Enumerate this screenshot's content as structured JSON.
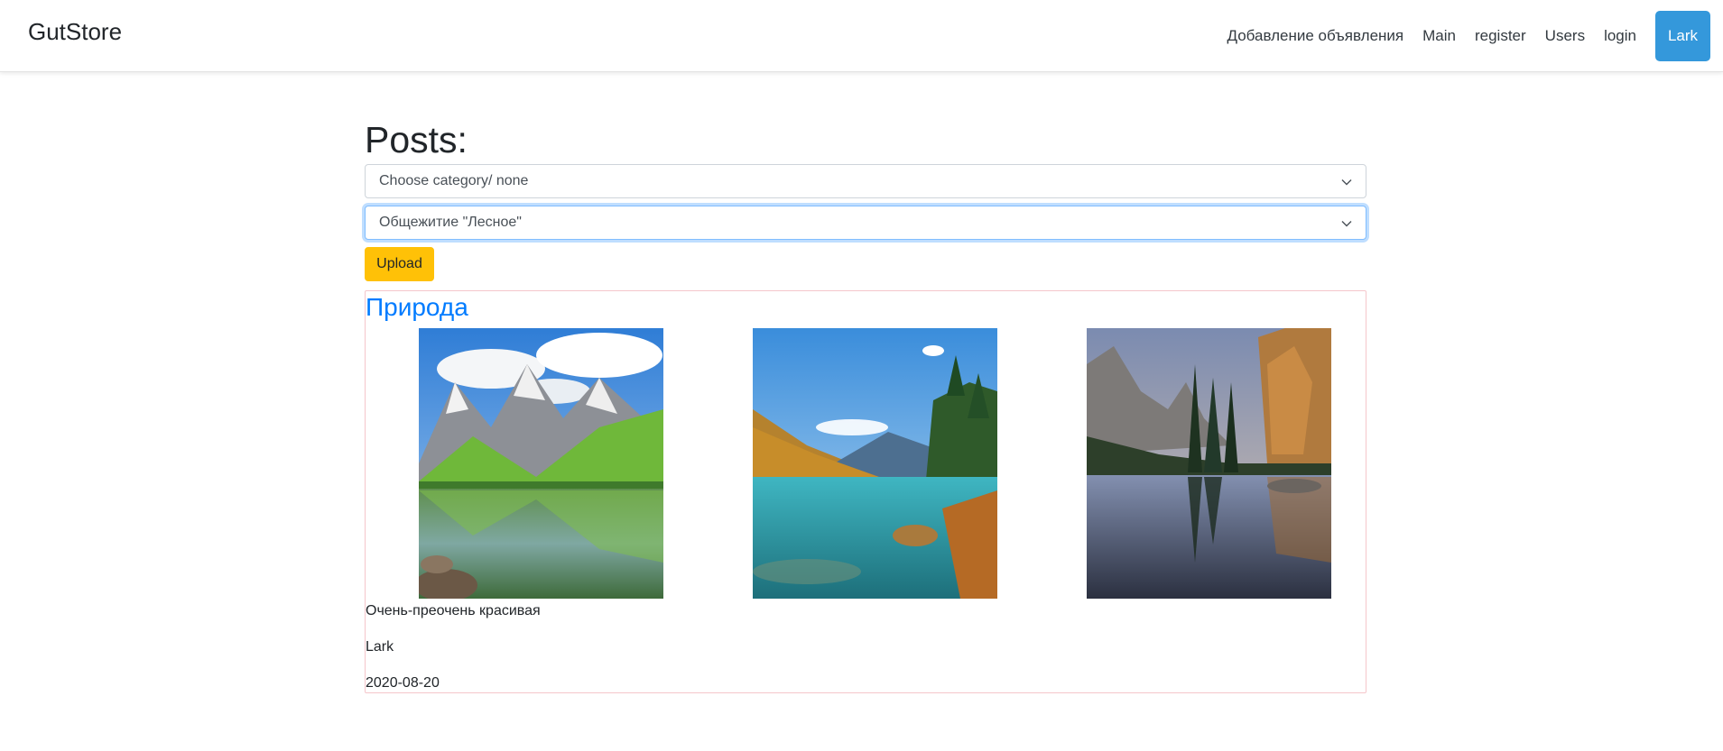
{
  "navbar": {
    "brand": "GutStore",
    "links": [
      "Добавление объявления",
      "Main",
      "register",
      "Users",
      "login"
    ],
    "user": "Lark",
    "user_color": "#3498db"
  },
  "main": {
    "title": "Posts:",
    "category_select": {
      "value": "Choose category/ none"
    },
    "location_select": {
      "value": "Общежитие \"Лесное\""
    },
    "upload_label": "Upload",
    "upload_color": "#ffc107"
  },
  "post": {
    "title": "Природа",
    "title_color": "#007bff",
    "images": [
      "mountain-lake-green-valley",
      "turquoise-lake-autumn-forest",
      "mountain-lake-pine-reflection"
    ],
    "description": "Очень-преочень красивая",
    "author": "Lark",
    "date": "2020-08-20"
  }
}
